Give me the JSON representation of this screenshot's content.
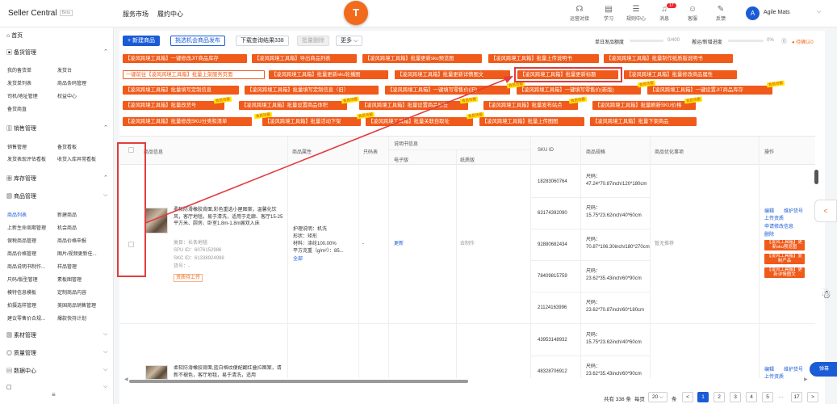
{
  "header": {
    "brand": "Seller Central",
    "beta": "Beta",
    "nav": [
      "服务市场",
      "履约中心"
    ],
    "logo": "T",
    "tools": [
      {
        "label": "运营对接",
        "icon": "headset-icon"
      },
      {
        "label": "学习",
        "icon": "book-icon"
      },
      {
        "label": "规则中心",
        "icon": "rule-icon"
      },
      {
        "label": "消息",
        "icon": "bell-icon",
        "badge": "17"
      },
      {
        "label": "客服",
        "icon": "service-icon"
      },
      {
        "label": "反馈",
        "icon": "feedback-icon"
      }
    ],
    "user": "Agile Mats",
    "avatar": "A"
  },
  "sidebar": {
    "sections": [
      {
        "label": "首页",
        "icon": "home-icon"
      },
      {
        "label": "备货管理",
        "icon": "box-icon",
        "items": [
          "我的备货单",
          "发货台",
          "发货单列表",
          "商品条码管理",
          "司机/地址管理",
          "权益中心",
          "备货商直"
        ]
      },
      {
        "label": "销售管理",
        "icon": "sales-icon",
        "items": [
          "销售管理",
          "备货看板",
          "发货表现评估看板",
          "收货入库异常看板"
        ]
      },
      {
        "label": "库存管理",
        "icon": "stock-icon"
      },
      {
        "label": "商品管理",
        "icon": "product-icon",
        "items": [
          "商品列表",
          "新建商品",
          "上新生命周期管理",
          "机会商品",
          "保税商品管理",
          "商品价格申报",
          "商品价格管理",
          "图片/视频更新任...",
          "商品说明书制作...",
          "样品管理",
          "尺码/版型管理",
          "素板图管理",
          "模特信息模板",
          "定制商品内容",
          "拍摄选样管理",
          "美国商品销售管理",
          "建议零售价合规...",
          "爆款快持计划"
        ]
      },
      {
        "label": "素材管理",
        "icon": "material-icon"
      },
      {
        "label": "质量管理",
        "icon": "quality-icon"
      },
      {
        "label": "数据中心",
        "icon": "data-icon"
      },
      {
        "label": "",
        "icon": "more-icon"
      }
    ]
  },
  "toolbar": {
    "new": "+ 新建商品",
    "opp": "挑选机会商品发布",
    "export": "下载查询结果338",
    "batch_del": "批量删除",
    "more": "更多 ⌵"
  },
  "quota": {
    "label1": "单日发品额度",
    "val1": "0/400",
    "label2": "搬运/新增进度",
    "val2": "0%",
    "warn": "待确认0",
    "help_icon": "help-icon"
  },
  "plugin_buttons": [
    [
      "【凌风跨境工具箱】一键修改JIT商品库存",
      "【凌风跨境工具箱】导出商品列表",
      "【凌风跨境工具箱】批量更新sku预览图",
      "【凌风跨境工具箱】批量上传说明书",
      "【凌风跨境工具箱】批量制作纸质版说明书"
    ],
    [
      "一键前往【凌风跨境工具箱】批量上架服务页面",
      "【凌风跨境工具箱】批量更新sku轮播图",
      "【凌风跨境工具箱】批量更新详情图文",
      "【凌风跨境工具箱】批量更新标题",
      "【凌风跨境工具箱】批量修改商品属性"
    ],
    [
      "【凌风跨境工具箱】批量填写定制信息",
      "【凌风跨境工具箱】批量填写定制信息（旧）",
      "【凌风跨境工具箱】一键填写零售价(旧)",
      "【凌风跨境工具箱】一键填写零售价(新版)",
      "【凌风跨境工具箱】一键设置JIT商品库存"
    ],
    [
      "【凌风跨境工具箱】批量改货号",
      "【凌风跨境工具箱】批量设置商品体积",
      "【凌风跨境工具箱】批量设置商品标签",
      "【凌风跨境工具箱】批量发布站点",
      "【凌风跨境工具箱】批量刷新SKU价格"
    ],
    [
      "【凌风跨境工具箱】批量修改SKU分类和清单",
      "【凌风跨境工具箱】批量活动下架",
      "【凌风跨境工具箱】批量关联自取址",
      "【凌风跨境工具箱】批量上传图图",
      "【凌风跨境工具箱】批量下架商品"
    ]
  ],
  "ribbon": "会员功能",
  "table": {
    "headers": {
      "info": "商品信息",
      "attrs": "商品属性",
      "code": "只码表",
      "manual": "说明书信息",
      "e": "电子版",
      "paper": "纸质版",
      "sku": "SKU ID",
      "spec": "商品规格",
      "opt": "商品优化事项",
      "ops": "操作"
    },
    "row1": {
      "title": "柔软防滑橡胶背面,彩色重选小屋图案，温馨化饮风，客厅地毯，易于清洗，适用于走廊、客厅15-25平方米、厨房、卧室1.8m-1.8m展双入床",
      "category": "类目：长条地毯",
      "spu": "SPU ID：6076152986",
      "skc": "SKC ID：61338924998",
      "huohao": "货号：-",
      "status": "资质待上传",
      "attrs": [
        "护理说明：机洗",
        "形状：矩形",
        "材料：涤纶100.00%",
        "平方克重（g/m²）：85...",
        "全部"
      ],
      "code": "-",
      "manual_e": "更新",
      "manual_p": "去制作",
      "opt": "暂无推荐",
      "skus": [
        {
          "id": "18283060764",
          "spec": "尺码：47.24*70.87inch/120*180cm"
        },
        {
          "id": "63174392090",
          "spec": "尺码：15.75*23.62inch/40*60cm"
        },
        {
          "id": "92880682434",
          "spec": "尺码：70.87*106.30inch/180*270cm"
        },
        {
          "id": "78409815759",
          "spec": "尺码：23.62*35.43inch/60*90cm"
        },
        {
          "id": "21124163996",
          "spec": "尺码：23.62*70.87inch/60*180cm"
        }
      ],
      "ops": [
        "编辑",
        "维护货号",
        "上传资质",
        "申请修改信息",
        "删除"
      ],
      "ops_tags": [
        "【凌风工具箱】更新sku预览图",
        "【凌风工具箱】复制产品",
        "【凌风工具箱】更新详情图文"
      ]
    },
    "row2": {
      "title": "柔软防滑橡胶背面,蓝白格纹便配翻红叠拉图案，请新不褪色，客厅地毯，易于清洗，适用",
      "skus": [
        {
          "id": "43953148932",
          "spec": "尺码：15.75*23.62inch/40*60cm"
        },
        {
          "id": "48328706912",
          "spec": "尺码：23.62*35.43inch/60*90cm"
        }
      ],
      "ops": [
        "编辑",
        "维护货号",
        "上传资质"
      ]
    }
  },
  "pager": {
    "total": "共有 338 条",
    "per_label": "每页",
    "per": "20",
    "unit": "条",
    "pages": [
      "1",
      "2",
      "3",
      "4",
      "5",
      "···",
      "17"
    ],
    "prev": "<",
    "next": ">"
  },
  "float_btn": "弹幕",
  "float_icon": "<"
}
